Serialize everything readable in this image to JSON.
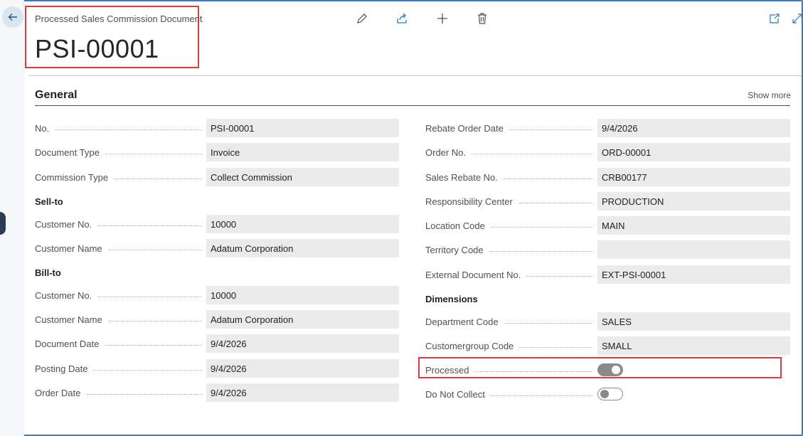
{
  "page": {
    "caption": "Processed Sales Commission Document",
    "title": "PSI-00001"
  },
  "toolbar": {
    "edit_icon": "pencil-icon",
    "share_icon": "share-icon",
    "new_icon": "plus-icon",
    "delete_icon": "trash-icon",
    "open_new_window_icon": "open-in-new-window-icon",
    "expand_icon": "expand-icon"
  },
  "section": {
    "title": "General",
    "show_more": "Show more"
  },
  "left": {
    "no": {
      "label": "No.",
      "value": "PSI-00001"
    },
    "document_type": {
      "label": "Document Type",
      "value": "Invoice"
    },
    "commission_type": {
      "label": "Commission Type",
      "value": "Collect Commission"
    },
    "sell_to_heading": "Sell-to",
    "sell_to_customer_no": {
      "label": "Customer No.",
      "value": "10000"
    },
    "sell_to_customer_name": {
      "label": "Customer Name",
      "value": "Adatum Corporation"
    },
    "bill_to_heading": "Bill-to",
    "bill_to_customer_no": {
      "label": "Customer No.",
      "value": "10000"
    },
    "bill_to_customer_name": {
      "label": "Customer Name",
      "value": "Adatum Corporation"
    },
    "document_date": {
      "label": "Document Date",
      "value": "9/4/2026"
    },
    "posting_date": {
      "label": "Posting Date",
      "value": "9/4/2026"
    },
    "order_date": {
      "label": "Order Date",
      "value": "9/4/2026"
    }
  },
  "right": {
    "rebate_order_date": {
      "label": "Rebate Order Date",
      "value": "9/4/2026"
    },
    "order_no": {
      "label": "Order No.",
      "value": "ORD-00001"
    },
    "sales_rebate_no": {
      "label": "Sales Rebate No.",
      "value": "CRB00177"
    },
    "responsibility_center": {
      "label": "Responsibility Center",
      "value": "PRODUCTION"
    },
    "location_code": {
      "label": "Location Code",
      "value": "MAIN"
    },
    "territory_code": {
      "label": "Territory Code",
      "value": ""
    },
    "external_document_no": {
      "label": "External Document No.",
      "value": "EXT-PSI-00001"
    },
    "dimensions_heading": "Dimensions",
    "department_code": {
      "label": "Department Code",
      "value": "SALES"
    },
    "customergroup_code": {
      "label": "Customergroup Code",
      "value": "SMALL"
    },
    "processed": {
      "label": "Processed",
      "value": true
    },
    "do_not_collect": {
      "label": "Do Not Collect",
      "value": false
    }
  }
}
